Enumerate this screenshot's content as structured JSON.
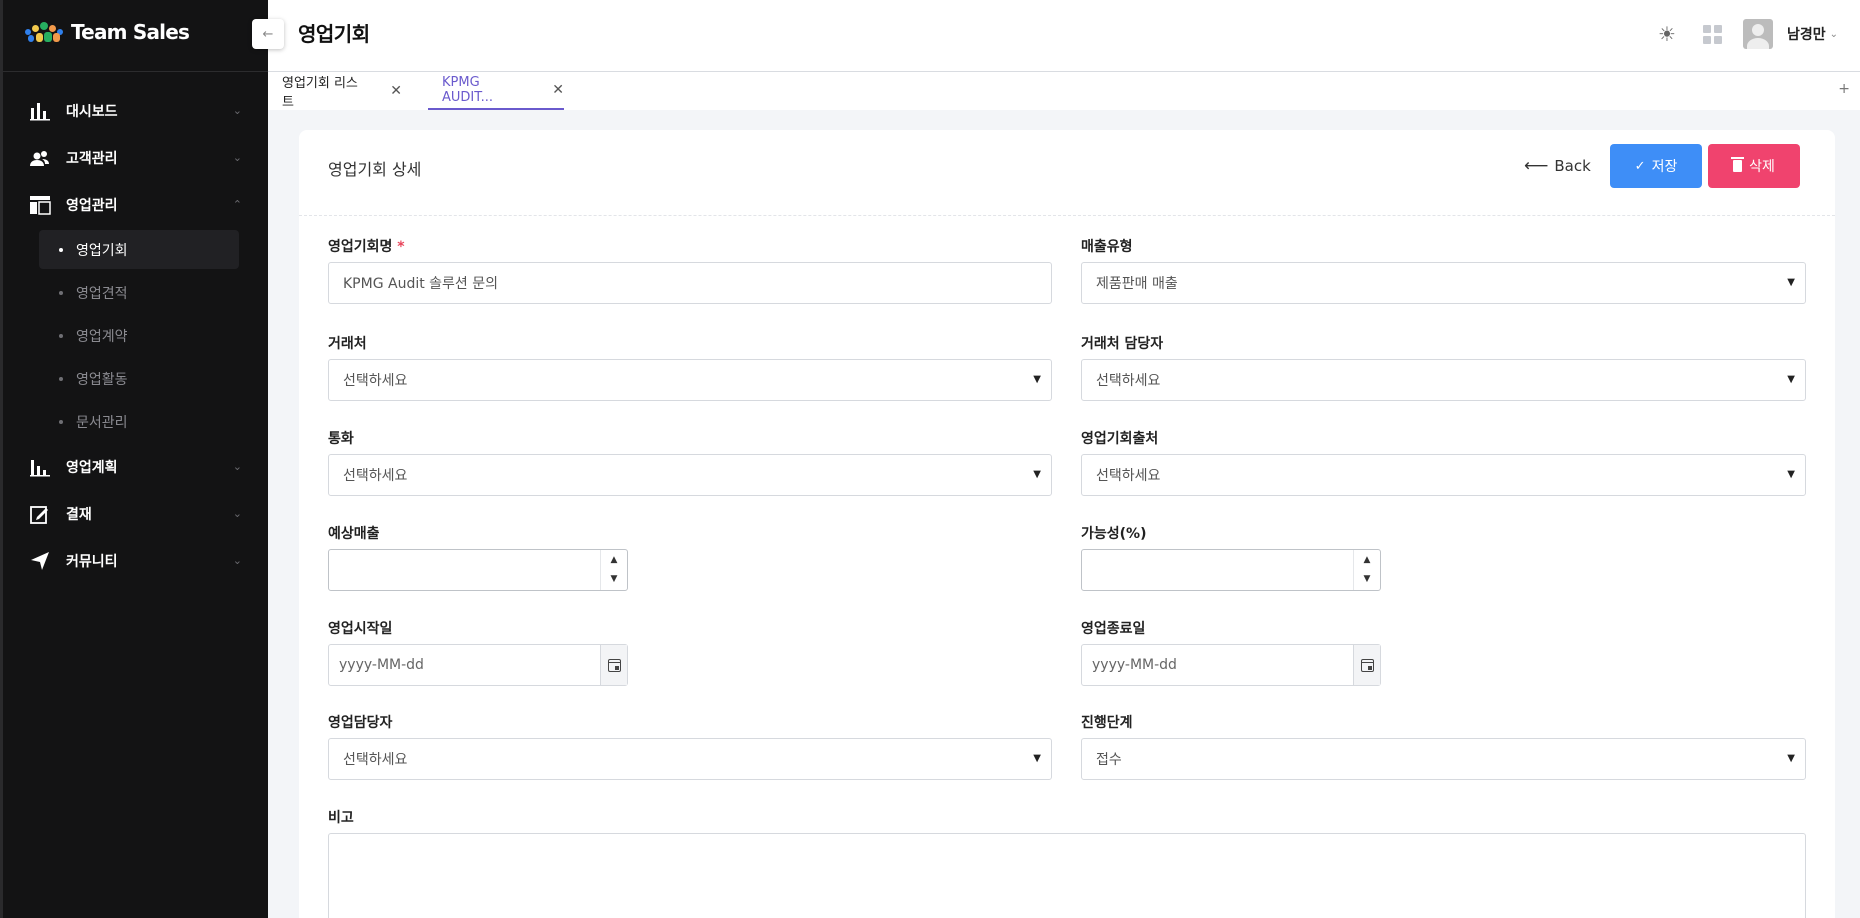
{
  "sidebar": {
    "brand": "Team Sales",
    "collapse_icon": "←",
    "menu": [
      {
        "label": "대시보드",
        "icon": "bar-chart"
      },
      {
        "label": "고객관리",
        "icon": "users"
      },
      {
        "label": "영업관리",
        "icon": "layout",
        "expanded": true
      },
      {
        "label": "영업계획",
        "icon": "bar-chart"
      },
      {
        "label": "결재",
        "icon": "edit"
      },
      {
        "label": "커뮤니티",
        "icon": "send"
      }
    ],
    "submenu": [
      "영업기회",
      "영업견적",
      "영업계약",
      "영업활동",
      "문서관리"
    ]
  },
  "header": {
    "title": "영업기회",
    "user_name": "남경만"
  },
  "tabs": [
    {
      "label": "영업기회 리스트"
    },
    {
      "label": "KPMG AUDIT..."
    }
  ],
  "card": {
    "title": "영업기회 상세",
    "back_label": "Back",
    "save_label": "저장",
    "delete_label": "삭제"
  },
  "form": {
    "name": {
      "label": "영업기회명",
      "required_mark": "*",
      "value": "KPMG Audit 솔루션 문의"
    },
    "sales_type": {
      "label": "매출유형",
      "value": "제품판매 매출"
    },
    "account": {
      "label": "거래처",
      "value": "선택하세요"
    },
    "account_contact": {
      "label": "거래처 담당자",
      "value": "선택하세요"
    },
    "currency": {
      "label": "통화",
      "value": "선택하세요"
    },
    "source": {
      "label": "영업기회출처",
      "value": "선택하세요"
    },
    "expected_revenue": {
      "label": "예상매출",
      "value": ""
    },
    "probability": {
      "label": "가능성(%)",
      "value": ""
    },
    "start_date": {
      "label": "영업시작일",
      "placeholder": "yyyy-MM-dd"
    },
    "end_date": {
      "label": "영업종료일",
      "placeholder": "yyyy-MM-dd"
    },
    "owner": {
      "label": "영업담당자",
      "value": "선택하세요"
    },
    "stage": {
      "label": "진행단계",
      "value": "접수"
    },
    "note": {
      "label": "비고",
      "value": ""
    }
  },
  "colors": {
    "sidebar_bg": "#131314",
    "accent_tab": "#6a5acd",
    "save": "#3e8ef7",
    "delete": "#f0436e",
    "required": "#e8445a"
  }
}
